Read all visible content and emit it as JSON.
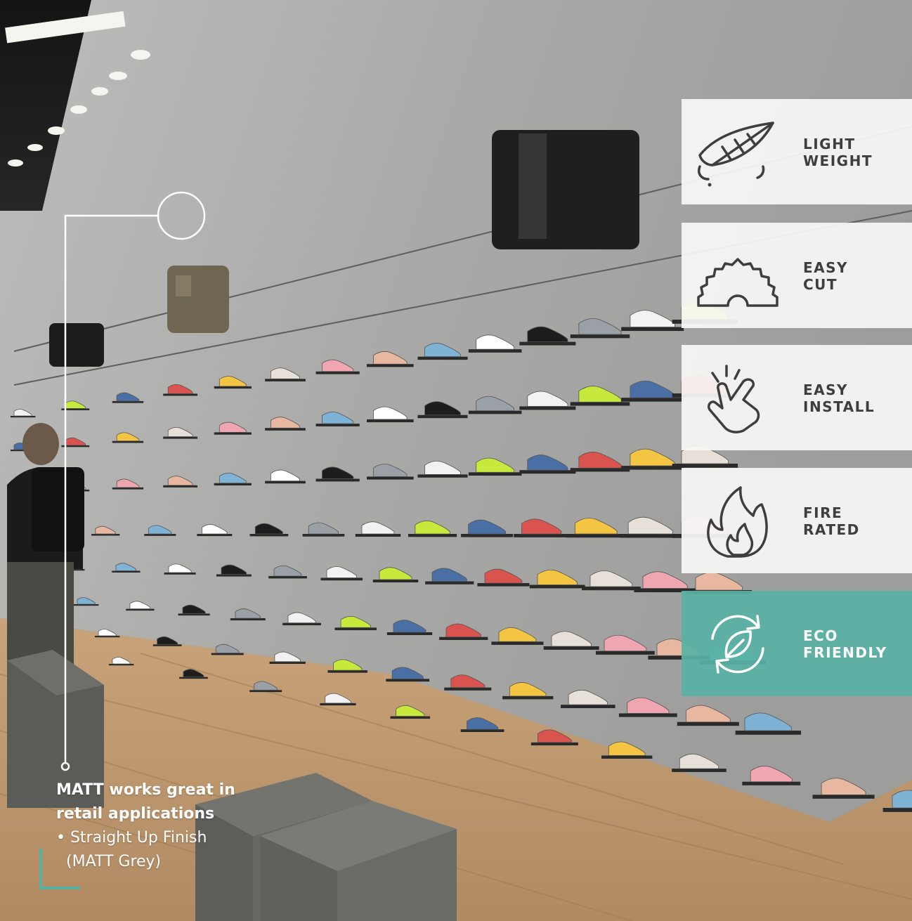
{
  "colors": {
    "accent": "#58b2a4",
    "panel": "#f8f8f6",
    "label_dark": "#3e3e3e",
    "caption": "#ffffff"
  },
  "features": [
    {
      "icon": "feather-icon",
      "lines": [
        "LIGHT",
        "WEIGHT"
      ],
      "highlighted": false
    },
    {
      "icon": "saw-blade-icon",
      "lines": [
        "EASY",
        "CUT"
      ],
      "highlighted": false
    },
    {
      "icon": "hand-tap-icon",
      "lines": [
        "EASY",
        "INSTALL"
      ],
      "highlighted": false
    },
    {
      "icon": "flame-icon",
      "lines": [
        "FIRE",
        "RATED"
      ],
      "highlighted": false
    },
    {
      "icon": "eco-leaf-icon",
      "lines": [
        "ECO",
        "FRIENDLY"
      ],
      "highlighted": true
    }
  ],
  "caption": {
    "title_line1": "MATT works great in",
    "title_line2": "retail applications",
    "detail_line1": "• Straight Up Finish",
    "detail_line2": "(MATT Grey)"
  }
}
